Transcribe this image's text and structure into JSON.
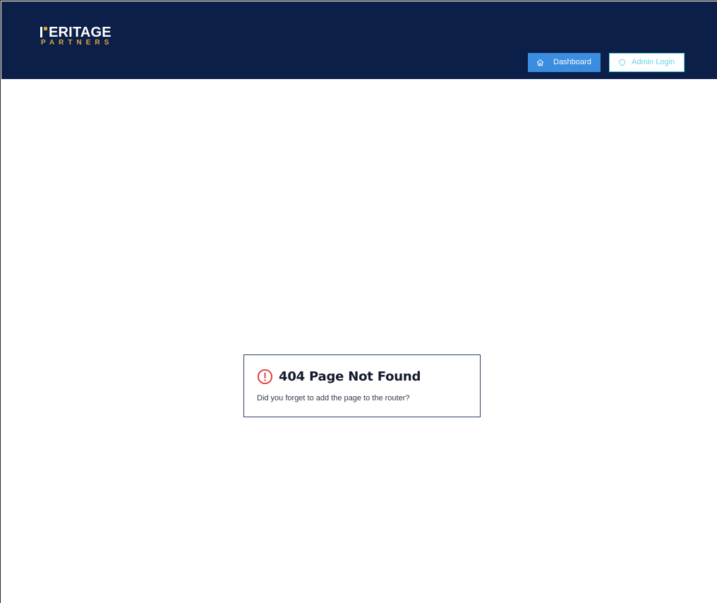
{
  "header": {
    "logo": {
      "top_text": "ERITAGE",
      "bottom_text": "PARTNERS",
      "accent_color": "#e0a83a"
    },
    "background_color": "#0c1f48",
    "buttons": {
      "dashboard": {
        "label": "Dashboard",
        "icon": "home-icon",
        "color": "#3b8de0"
      },
      "admin_login": {
        "label": "Admin Login",
        "icon": "shield-icon",
        "color": "#62d4e6"
      }
    }
  },
  "error_card": {
    "icon": "alert-circle-icon",
    "icon_color": "#e23b3b",
    "title": "404 Page Not Found",
    "description": "Did you forget to add the page to the router?"
  }
}
